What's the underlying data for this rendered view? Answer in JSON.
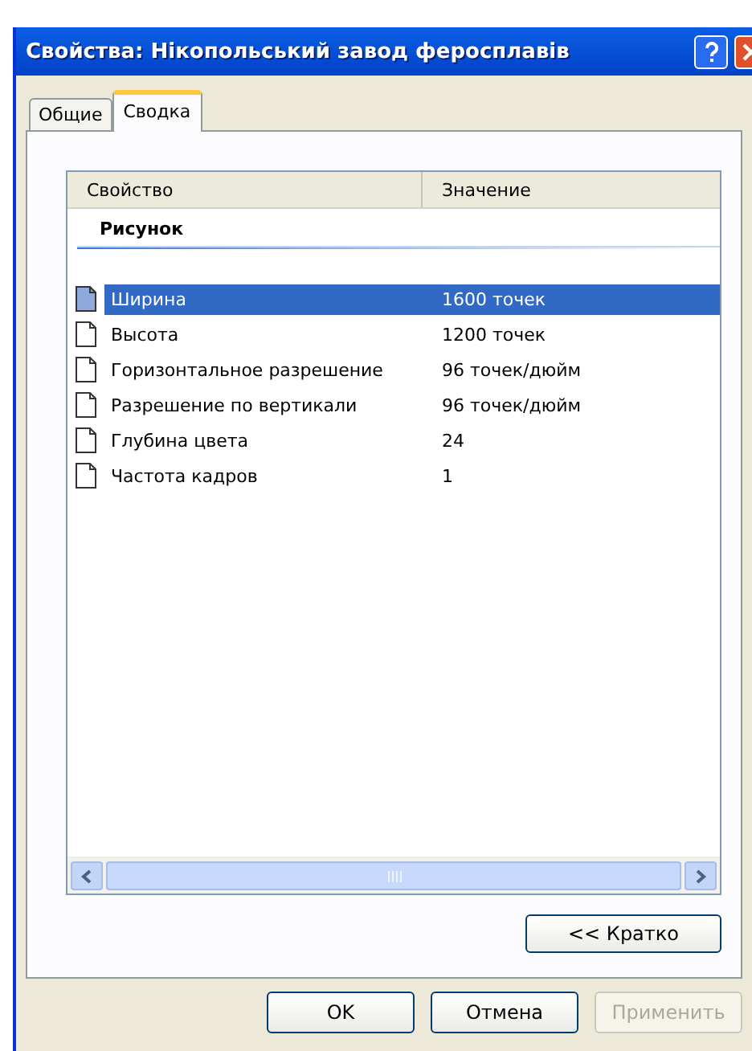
{
  "window": {
    "title": "Свойства: Нікопольський завод феросплавів"
  },
  "tabs": [
    {
      "label": "Общие",
      "selected": false
    },
    {
      "label": "Сводка",
      "selected": true
    }
  ],
  "table": {
    "columns": [
      "Свойство",
      "Значение"
    ],
    "group": "Рисунок",
    "rows": [
      {
        "property": "Ширина",
        "value": "1600 точек",
        "selected": true
      },
      {
        "property": "Высота",
        "value": "1200 точек",
        "selected": false
      },
      {
        "property": "Горизонтальное разрешение",
        "value": "96 точек/дюйм",
        "selected": false
      },
      {
        "property": "Разрешение по вертикали",
        "value": "96 точек/дюйм",
        "selected": false
      },
      {
        "property": "Глубина цвета",
        "value": "24",
        "selected": false
      },
      {
        "property": "Частота кадров",
        "value": "1",
        "selected": false
      }
    ]
  },
  "toggle_button": "<< Кратко",
  "buttons": [
    {
      "label": "OK",
      "disabled": false
    },
    {
      "label": "Отмена",
      "disabled": false
    },
    {
      "label": "Применить",
      "disabled": true
    }
  ]
}
